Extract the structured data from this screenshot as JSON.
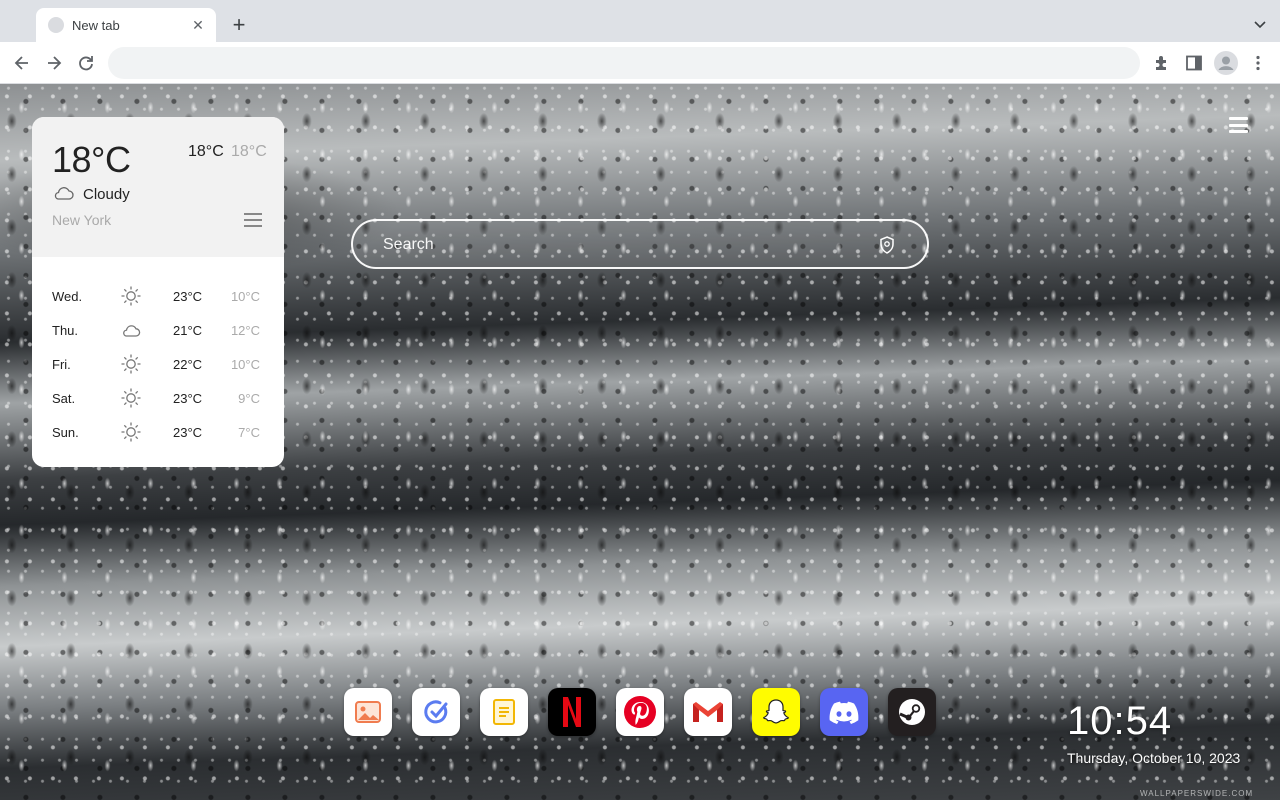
{
  "browser": {
    "tab_title": "New tab",
    "close_glyph": "✕",
    "new_tab_glyph": "+"
  },
  "weather": {
    "current_temp": "18°C",
    "high": "18°C",
    "low": "18°C",
    "condition": "Cloudy",
    "condition_icon": "cloud-icon",
    "city": "New York",
    "forecast": [
      {
        "day": "Wed.",
        "icon": "sun-icon",
        "high": "23°C",
        "low": "10°C"
      },
      {
        "day": "Thu.",
        "icon": "cloud-icon",
        "high": "21°C",
        "low": "12°C"
      },
      {
        "day": "Fri.",
        "icon": "sun-icon",
        "high": "22°C",
        "low": "10°C"
      },
      {
        "day": "Sat.",
        "icon": "sun-icon",
        "high": "23°C",
        "low": "9°C"
      },
      {
        "day": "Sun.",
        "icon": "sun-icon",
        "high": "23°C",
        "low": "7°C"
      }
    ]
  },
  "search": {
    "placeholder": "Search"
  },
  "dock": {
    "apps": [
      {
        "name": "photos",
        "icon": "image-icon",
        "bg": "#ffffff"
      },
      {
        "name": "tasks",
        "icon": "check-circle-icon",
        "bg": "#ffffff"
      },
      {
        "name": "notes",
        "icon": "note-icon",
        "bg": "#ffffff"
      },
      {
        "name": "netflix",
        "icon": "netflix-icon",
        "bg": "#000000"
      },
      {
        "name": "pinterest",
        "icon": "pinterest-icon",
        "bg": "#ffffff"
      },
      {
        "name": "gmail",
        "icon": "gmail-icon",
        "bg": "#ffffff"
      },
      {
        "name": "snapchat",
        "icon": "snapchat-icon",
        "bg": "#fffc00"
      },
      {
        "name": "discord",
        "icon": "discord-icon",
        "bg": "#5865f2"
      },
      {
        "name": "steam",
        "icon": "steam-icon",
        "bg": "#231f20"
      }
    ]
  },
  "clock": {
    "time": "10:54",
    "date": "Thursday, October 10, 2023"
  },
  "watermark": "WALLPAPERSWIDE.COM"
}
